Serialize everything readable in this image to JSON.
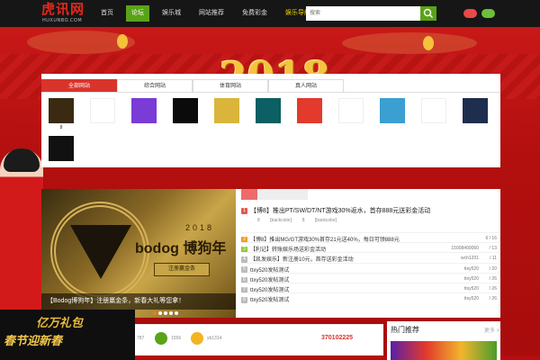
{
  "header": {
    "logo_text": "虎讯网",
    "logo_sub": "HUXUNBO.COM",
    "nav": [
      {
        "label": "首页",
        "active": false,
        "highlight": false
      },
      {
        "label": "论坛",
        "active": true,
        "highlight": false
      },
      {
        "label": "娱乐城",
        "active": false,
        "highlight": false
      },
      {
        "label": "网站推荐",
        "active": false,
        "highlight": false
      },
      {
        "label": "免费彩金",
        "active": false,
        "highlight": false
      },
      {
        "label": "娱乐导航",
        "active": false,
        "highlight": true
      }
    ],
    "search_placeholder": "搜索",
    "colors": {
      "accent": "#5aa318",
      "brand": "#e3281c",
      "pill_left": "#e8494a",
      "pill_right": "#6bbf3a"
    }
  },
  "banner": {
    "year": "2018",
    "slogan_line1": "亿万礼包",
    "slogan_line2": "春节迎新春"
  },
  "site_panel": {
    "tabs": [
      {
        "label": "全部网站",
        "active": true
      },
      {
        "label": "综合网站",
        "active": false
      },
      {
        "label": "体育网站",
        "active": false
      },
      {
        "label": "真人网站",
        "active": false
      }
    ],
    "sites": [
      {
        "name": "logo-gold",
        "label": "8",
        "color": "#3a2a12"
      },
      {
        "name": "logo-dragon",
        "label": "",
        "color": "#ffffff"
      },
      {
        "name": "logo-purple",
        "label": "",
        "color": "#7a3bd6"
      },
      {
        "name": "logo-black",
        "label": "",
        "color": "#0b0b0b"
      },
      {
        "name": "logo-gold-circle",
        "label": "",
        "color": "#d9b63b"
      },
      {
        "name": "logo-teal",
        "label": "",
        "color": "#0c5f62"
      },
      {
        "name": "logo-red",
        "label": "",
        "color": "#e23a2c"
      },
      {
        "name": "logo-funbb",
        "label": "",
        "color": "#ffffff"
      },
      {
        "name": "logo-diamond",
        "label": "",
        "color": "#3b9fd1"
      },
      {
        "name": "logo-f",
        "label": "",
        "color": "#ffffff"
      },
      {
        "name": "logo-betvictor",
        "label": "",
        "color": "#1f2e4e"
      },
      {
        "name": "logo-bodog",
        "label": "",
        "color": "#111111"
      }
    ]
  },
  "slider": {
    "year": "2018",
    "brand": "bodog 博狗年",
    "button": "注册赢金条",
    "caption": "【Bodog博狗年】注册赢金条，新春大礼等您拿！",
    "dots": 5,
    "active_dot": 0
  },
  "news": {
    "headline": {
      "num": "1",
      "title": "【博8】推出PT/SW/DT/NT游戏30%返水，首存888元送彩金活动",
      "meta": [
        "8",
        "[backcolor]",
        "8",
        "[backcolor]"
      ]
    },
    "rows": [
      {
        "num": "2",
        "title": "【博8】推出MG/GT游戏30%首存21元送40%，每日可领888元",
        "author": "",
        "count": "6 / 16",
        "color": "o"
      },
      {
        "num": "3",
        "title": "【利记】转账娱乐场送彩金活动",
        "author": "15008400060",
        "count": "/ 13",
        "color": "g"
      },
      {
        "num": "4",
        "title": "【凯发娱乐】新注册10元，首存送彩金活动",
        "author": "wch1201",
        "count": "/ 11",
        "color": ""
      },
      {
        "num": "5",
        "title": "ttxy520发帖测试",
        "author": "ttxy520",
        "count": "/ 20",
        "color": ""
      },
      {
        "num": "6",
        "title": "ttxy520发帖测试",
        "author": "ttxy520",
        "count": "/ 26",
        "color": ""
      },
      {
        "num": "7",
        "title": "ttxy520发帖测试",
        "author": "ttxy520",
        "count": "/ 26",
        "color": ""
      },
      {
        "num": "8",
        "title": "ttxy520发帖测试",
        "author": "ttxy520",
        "count": "/ 26",
        "color": ""
      }
    ]
  },
  "bottom": {
    "items": [
      {
        "text": "787",
        "color": "#4a90d9"
      },
      {
        "text": "1556",
        "color": "#5aa318"
      },
      {
        "text": "yb1314",
        "color": "#f3b421"
      }
    ],
    "phone": "370102225"
  },
  "side": {
    "title": "热门推荐",
    "more": "更多 >"
  }
}
